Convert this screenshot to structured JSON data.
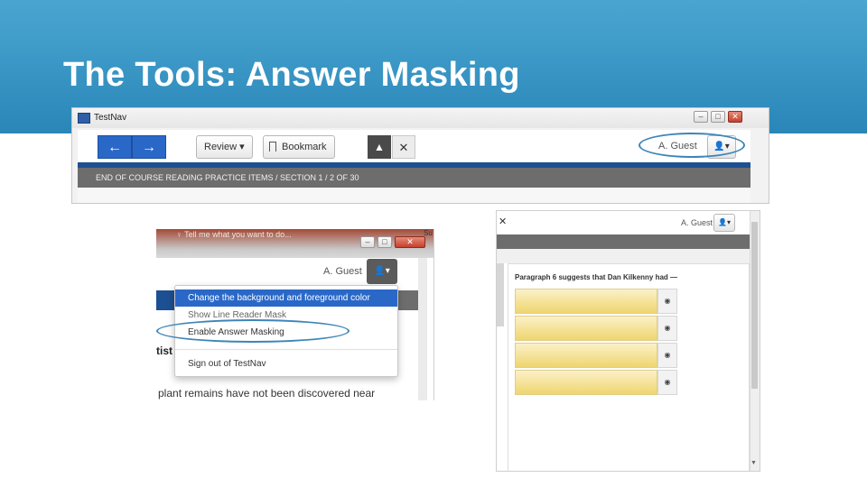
{
  "slide": {
    "title": "The Tools: Answer Masking"
  },
  "shot1": {
    "app_name": "TestNav",
    "nav_back": "←",
    "nav_forward": "→",
    "review_label": "Review ▾",
    "bookmark_label": "Bookmark",
    "pointer_glyph": "▲",
    "close_glyph": "✕",
    "guest_label": "A. Guest",
    "user_caret": "👤▾",
    "section_text": "END OF COURSE READING PRACTICE ITEMS   /   SECTION 1   /   2 OF 30",
    "win_min": "–",
    "win_max": "□",
    "win_close": "✕"
  },
  "shot2": {
    "tell_me": "♀ Tell me what you want to do...",
    "su_text": "Su",
    "guest_label": "A. Guest",
    "user_caret": "👤▾",
    "menu": [
      "Change the background and foreground color",
      "Show Line Reader Mask",
      "Enable Answer Masking",
      "Sign out of TestNav"
    ],
    "partial_heading": "tist",
    "passage_text": "plant remains have not been discovered near",
    "win_min": "–",
    "win_max": "□",
    "win_close": "✕"
  },
  "shot3": {
    "close_glyph": "✕",
    "guest_label": "A. Guest",
    "user_caret": "👤▾",
    "question": "Paragraph 6 suggests that Dan Kilkenny had —",
    "eye_glyph": "◉",
    "scroll_arrow": "▼"
  },
  "colors": {
    "header": "#2a86b8",
    "highlight_ring": "#3d86b8",
    "nav_blue": "#2a68c8",
    "mask_yellow": "#efd56f"
  }
}
